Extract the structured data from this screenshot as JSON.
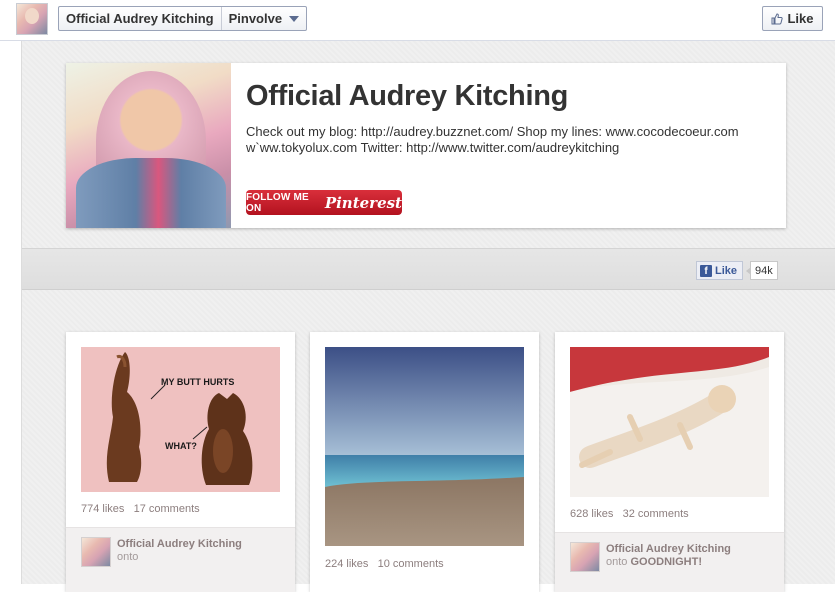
{
  "topbar": {
    "page_name": "Official Audrey Kitching",
    "app_name": "Pinvolve",
    "like_label": "Like"
  },
  "profile": {
    "name": "Official Audrey Kitching",
    "description": "Check out my blog: http://audrey.buzznet.com/ Shop my lines: www.cocodecoeur.com w`ww.tokyolux.com Twitter: http://www.twitter.com/audreykitching",
    "follow_prefix": "FOLLOW ME ON",
    "follow_brand": "Pinterest"
  },
  "facebook_like": {
    "label": "Like",
    "count": "94k"
  },
  "pins": [
    {
      "image_text": [
        "MY BUTT HURTS",
        "WHAT?"
      ],
      "likes": "774 likes",
      "comments": "17 comments",
      "author": "Official Audrey Kitching",
      "onto": "onto",
      "board": ""
    },
    {
      "likes": "224 likes",
      "comments": "10 comments"
    },
    {
      "likes": "628 likes",
      "comments": "32 comments",
      "author": "Official Audrey Kitching",
      "onto": "onto",
      "board": "GOODNIGHT!"
    }
  ],
  "colors": {
    "pinterest_red": "#c8232c",
    "facebook_blue": "#3b5998",
    "background": "#f0f0f0"
  }
}
